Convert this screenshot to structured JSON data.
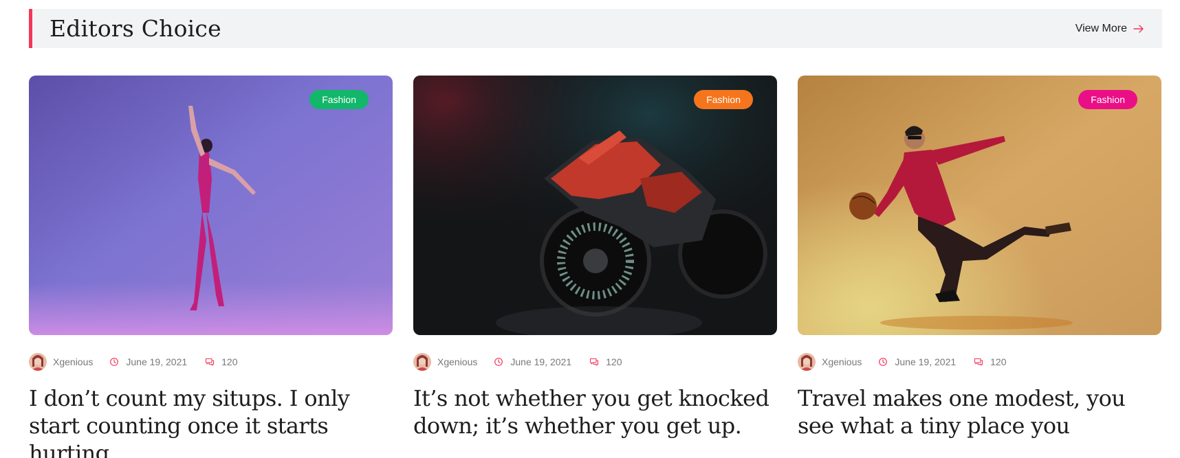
{
  "header": {
    "title": "Editors Choice",
    "view_more": "View More",
    "accent_color": "#f2385a"
  },
  "cards": [
    {
      "category": "Fashion",
      "category_color": "#12b76a",
      "author": "Xgenious",
      "date": "June 19, 2021",
      "comments": "120",
      "title": "I don’t count my situps. I only start counting once it starts hurting",
      "image": "ballet-dancer-purple"
    },
    {
      "category": "Fashion",
      "category_color": "#f5751d",
      "author": "Xgenious",
      "date": "June 19, 2021",
      "comments": "120",
      "title": "It’s not whether you get knocked down; it’s whether you get up.",
      "image": "red-motorcycle-dark"
    },
    {
      "category": "Fashion",
      "category_color": "#ea0f87",
      "author": "Xgenious",
      "date": "June 19, 2021",
      "comments": "120",
      "title": "Travel makes one modest, you see what a tiny place you",
      "image": "man-with-ball-orange"
    }
  ],
  "icons": {
    "date": "clock-icon",
    "comments": "comment-icon",
    "view_more": "arrow-right-icon"
  }
}
